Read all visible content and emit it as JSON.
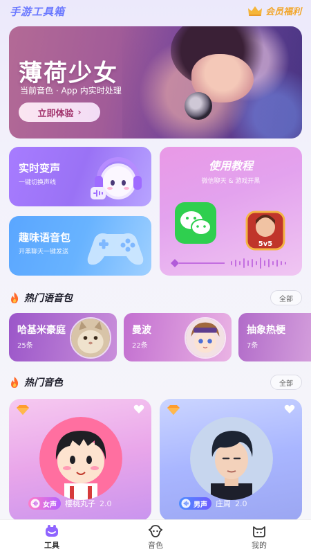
{
  "header": {
    "app_title": "手游工具箱",
    "vip_label": "会员福利",
    "vip_icon": "crown-icon"
  },
  "hero": {
    "title": "薄荷少女",
    "subtitle": "当前音色 · App 内实时处理",
    "button_label": "立即体验",
    "button_arrow": "›"
  },
  "features": {
    "realtime": {
      "title": "实时变声",
      "subtitle": "一键切换声线",
      "icon": "headset-icon"
    },
    "fun_pack": {
      "title": "趣味语音包",
      "subtitle": "开黑聊天一键发送",
      "icon": "gamepad-icon"
    },
    "tutorial": {
      "title": "使用教程",
      "subtitle": "微信聊天 & 游戏开黑",
      "icons": [
        "wechat-icon",
        "game-icon",
        "wave-icon"
      ]
    }
  },
  "hot_packs": {
    "title": "热门语音包",
    "all_label": "全部",
    "items": [
      {
        "name": "哈基米豪庭",
        "count": "25条"
      },
      {
        "name": "曼波",
        "count": "22条"
      },
      {
        "name": "抽象热梗",
        "count": "7条"
      }
    ]
  },
  "hot_voices": {
    "title": "热门音色",
    "all_label": "全部",
    "items": [
      {
        "gender": "女声",
        "name": "樱桃丸子",
        "version": "2.0"
      },
      {
        "gender": "男声",
        "name": "庄周",
        "version": "2.0"
      }
    ]
  },
  "tabbar": {
    "items": [
      {
        "label": "工具",
        "icon": "toolbox-icon",
        "active": true
      },
      {
        "label": "音色",
        "icon": "voice-icon",
        "active": false
      },
      {
        "label": "我的",
        "icon": "profile-icon",
        "active": false
      }
    ]
  },
  "colors": {
    "accent": "#6a78ff",
    "vip": "#f2a62a",
    "realtime_card": "#a77cff",
    "fun_card": "#5aa6ff",
    "tutorial_card": "#e999e6"
  }
}
